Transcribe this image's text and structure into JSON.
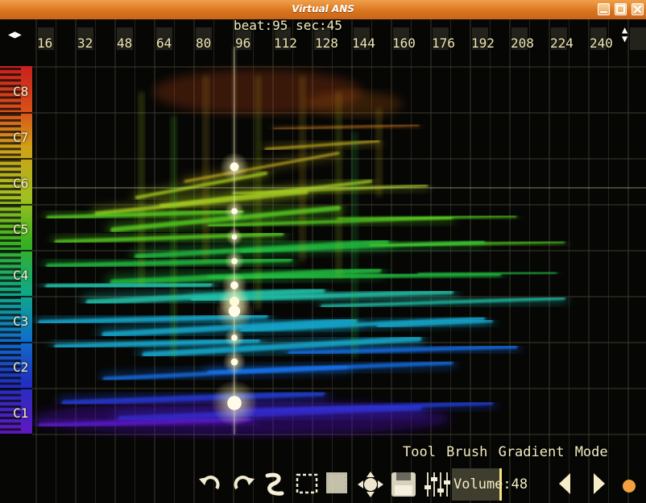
{
  "window": {
    "title": "Virtual ANS"
  },
  "status": {
    "beat_info": "beat:95 sec:45"
  },
  "x_ruler": {
    "ticks": [
      "16",
      "32",
      "48",
      "64",
      "80",
      "96",
      "112",
      "128",
      "144",
      "160",
      "176",
      "192",
      "208",
      "224",
      "240"
    ]
  },
  "pitch_ruler": {
    "labels": [
      "C8",
      "C7",
      "C6",
      "C5",
      "C4",
      "C3",
      "C2",
      "C1"
    ]
  },
  "tool_bar": {
    "tool_line": "Tool Brush Gradient Mode",
    "volume_label": "Volume",
    "volume_value": "48",
    "volume_fraction": 0.48,
    "icons": [
      "undo-icon",
      "redo-icon",
      "brush-icon",
      "select-icon",
      "fill-select-icon",
      "move-icon",
      "save-icon",
      "mixer-icon",
      "prev-icon",
      "next-icon",
      "record-icon"
    ]
  },
  "colors": {
    "title_bar": "#d8721c",
    "hud_text": "#f2ecc0",
    "accent": "#f4a040"
  }
}
